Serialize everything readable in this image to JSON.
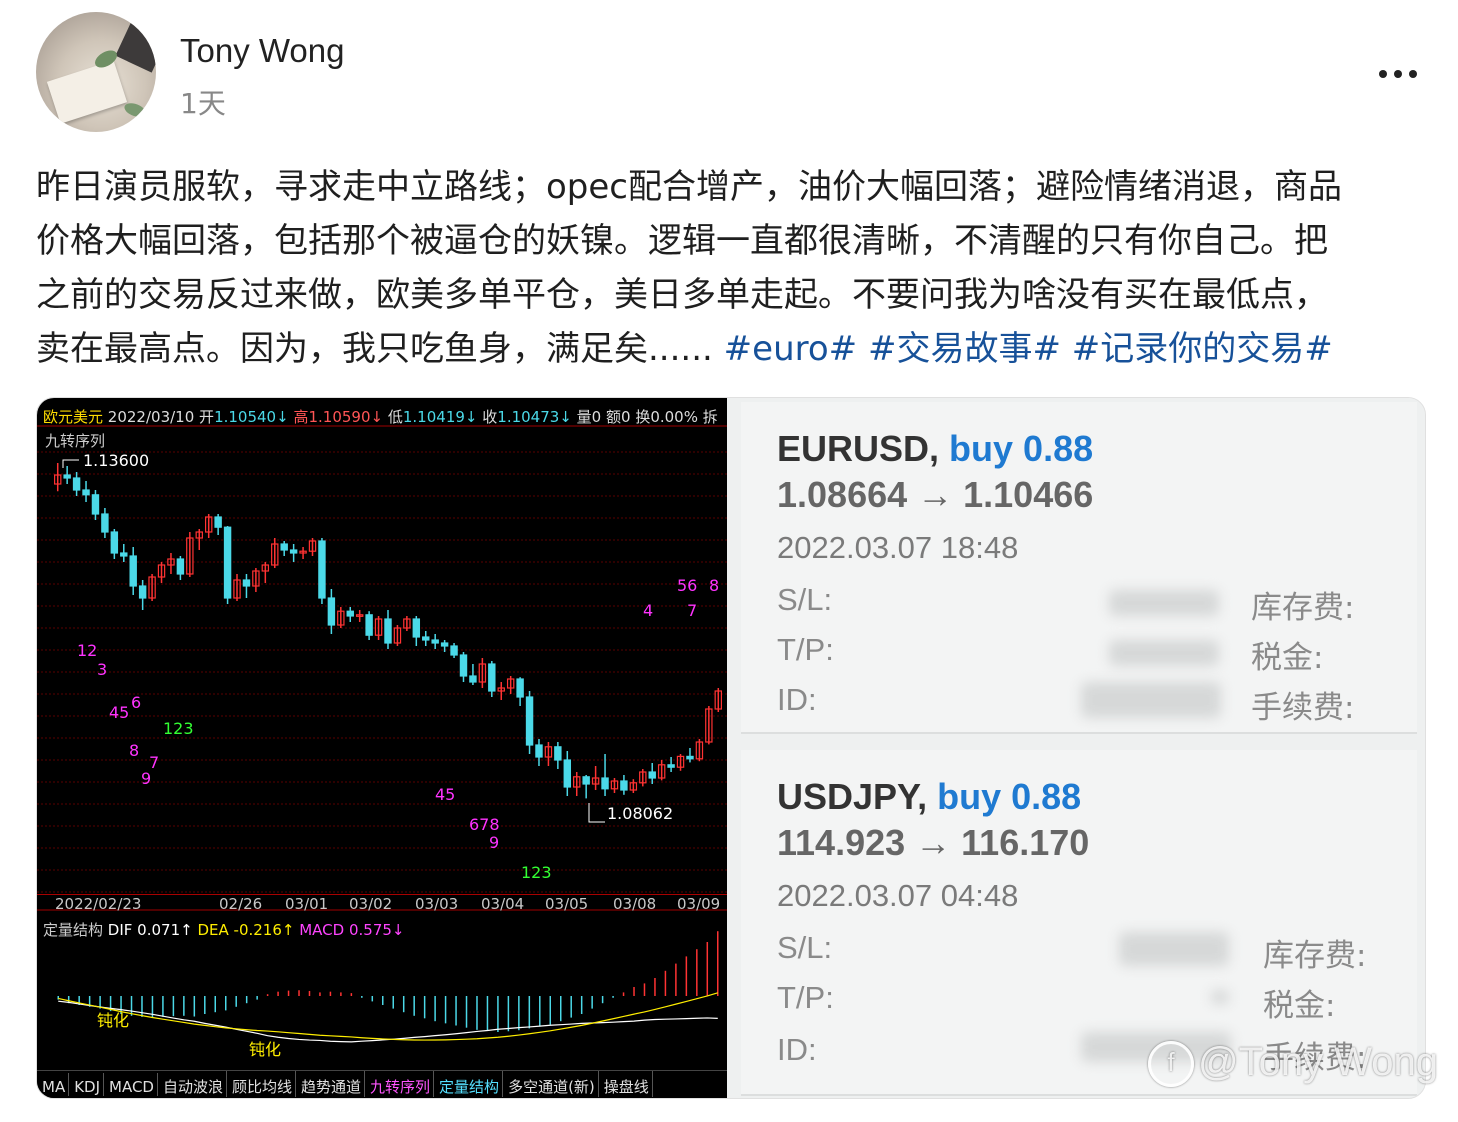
{
  "author": {
    "name": "Tony Wong",
    "time": "1天"
  },
  "more_icon": "more-dots-icon",
  "post": {
    "lines": [
      "昨日演员服软，寻求走中立路线；opec配合增产，油价大幅回落；避险情绪消退，商品",
      "价格大幅回落，包括那个被逼仓的妖镍。逻辑一直都很清晰，不清醒的只有你自己。把",
      "之前的交易反过来做，欧美多单平仓，美日多单走起。不要问我为啥没有买在最低点，"
    ],
    "last_line": "卖在最高点。因为，我只吃鱼身，满足矣......",
    "hashtags": [
      "#euro#",
      "#交易故事#",
      "#记录你的交易#"
    ]
  },
  "chart": {
    "name": "欧元美元",
    "date": "2022/03/10",
    "open_label": "开",
    "open": "1.10540↓",
    "high_label": "高",
    "high": "1.10590↓",
    "low_label": "低",
    "low": "1.10419↓",
    "close_label": "收",
    "close": "1.10473↓",
    "volume": "量0",
    "amount": "额0",
    "turnover": "换0.00%",
    "extra": "拆",
    "indicator": "九转序列",
    "high_marker": "1.13600",
    "low_marker": "1.08062",
    "dates": [
      "2022/02/23",
      "02/26",
      "03/01",
      "03/02",
      "03/03",
      "03/04",
      "03/05",
      "03/08",
      "03/09"
    ],
    "macd_label": "定量结构",
    "dif": "DIF 0.071↑",
    "dea": "DEA -0.216↑",
    "macd": "MACD 0.575↓",
    "tags": [
      "钝化",
      "钝化"
    ],
    "seq_labels": [
      "12",
      "3",
      "45",
      "6",
      "8",
      "7",
      "9",
      "123",
      "45",
      "678",
      "9",
      "123",
      "4",
      "56",
      "7",
      "8"
    ],
    "tabs": [
      "MA",
      "KDJ",
      "MACD",
      "自动波浪",
      "顾比均线",
      "趋势通道",
      "九转序列",
      "定量结构",
      "多空通道(新)",
      "操盘线"
    ],
    "colors": {
      "up": "#ff3333",
      "down": "#4bd9e8",
      "seq_magenta": "#ff33ff",
      "seq_green": "#33ff33"
    }
  },
  "chart_data": {
    "type": "candlestick",
    "series": [
      {
        "o": 1.133,
        "h": 1.1365,
        "l": 1.1318,
        "c": 1.1345
      },
      {
        "o": 1.1345,
        "h": 1.136,
        "l": 1.133,
        "c": 1.134
      },
      {
        "o": 1.134,
        "h": 1.135,
        "l": 1.131,
        "c": 1.132
      },
      {
        "o": 1.132,
        "h": 1.1335,
        "l": 1.13,
        "c": 1.1312
      },
      {
        "o": 1.1312,
        "h": 1.132,
        "l": 1.127,
        "c": 1.128
      },
      {
        "o": 1.128,
        "h": 1.129,
        "l": 1.124,
        "c": 1.125
      },
      {
        "o": 1.125,
        "h": 1.1255,
        "l": 1.1205,
        "c": 1.1215
      },
      {
        "o": 1.1215,
        "h": 1.123,
        "l": 1.12,
        "c": 1.121
      },
      {
        "o": 1.121,
        "h": 1.1225,
        "l": 1.1145,
        "c": 1.116
      },
      {
        "o": 1.116,
        "h": 1.117,
        "l": 1.112,
        "c": 1.114
      },
      {
        "o": 1.114,
        "h": 1.118,
        "l": 1.1135,
        "c": 1.1175
      },
      {
        "o": 1.1175,
        "h": 1.12,
        "l": 1.1165,
        "c": 1.1195
      },
      {
        "o": 1.1195,
        "h": 1.1215,
        "l": 1.118,
        "c": 1.1205
      },
      {
        "o": 1.1205,
        "h": 1.121,
        "l": 1.117,
        "c": 1.118
      },
      {
        "o": 1.118,
        "h": 1.125,
        "l": 1.1175,
        "c": 1.124
      },
      {
        "o": 1.124,
        "h": 1.1255,
        "l": 1.122,
        "c": 1.125
      },
      {
        "o": 1.125,
        "h": 1.128,
        "l": 1.124,
        "c": 1.1275
      },
      {
        "o": 1.1275,
        "h": 1.128,
        "l": 1.1245,
        "c": 1.1258
      },
      {
        "o": 1.1258,
        "h": 1.126,
        "l": 1.113,
        "c": 1.114
      },
      {
        "o": 1.114,
        "h": 1.118,
        "l": 1.1135,
        "c": 1.117
      },
      {
        "o": 1.117,
        "h": 1.118,
        "l": 1.114,
        "c": 1.116
      },
      {
        "o": 1.116,
        "h": 1.119,
        "l": 1.115,
        "c": 1.1185
      },
      {
        "o": 1.1185,
        "h": 1.12,
        "l": 1.1165,
        "c": 1.1195
      },
      {
        "o": 1.1195,
        "h": 1.124,
        "l": 1.119,
        "c": 1.123
      },
      {
        "o": 1.123,
        "h": 1.1235,
        "l": 1.121,
        "c": 1.122
      },
      {
        "o": 1.122,
        "h": 1.123,
        "l": 1.12,
        "c": 1.1215
      },
      {
        "o": 1.1215,
        "h": 1.1225,
        "l": 1.1205,
        "c": 1.1218
      },
      {
        "o": 1.1218,
        "h": 1.124,
        "l": 1.121,
        "c": 1.1235
      },
      {
        "o": 1.1235,
        "h": 1.124,
        "l": 1.113,
        "c": 1.114
      },
      {
        "o": 1.114,
        "h": 1.1155,
        "l": 1.108,
        "c": 1.1095
      },
      {
        "o": 1.1095,
        "h": 1.1125,
        "l": 1.109,
        "c": 1.1118
      },
      {
        "o": 1.1118,
        "h": 1.1125,
        "l": 1.11,
        "c": 1.111
      },
      {
        "o": 1.111,
        "h": 1.112,
        "l": 1.11,
        "c": 1.1112
      },
      {
        "o": 1.1112,
        "h": 1.1118,
        "l": 1.107,
        "c": 1.1078
      },
      {
        "o": 1.1078,
        "h": 1.111,
        "l": 1.107,
        "c": 1.1105
      },
      {
        "o": 1.1105,
        "h": 1.112,
        "l": 1.1055,
        "c": 1.1065
      },
      {
        "o": 1.1065,
        "h": 1.1095,
        "l": 1.106,
        "c": 1.109
      },
      {
        "o": 1.109,
        "h": 1.111,
        "l": 1.1085,
        "c": 1.1105
      },
      {
        "o": 1.1105,
        "h": 1.111,
        "l": 1.106,
        "c": 1.1075
      },
      {
        "o": 1.1075,
        "h": 1.1085,
        "l": 1.106,
        "c": 1.107
      },
      {
        "o": 1.107,
        "h": 1.108,
        "l": 1.1055,
        "c": 1.1065
      },
      {
        "o": 1.1065,
        "h": 1.107,
        "l": 1.105,
        "c": 1.106
      },
      {
        "o": 1.106,
        "h": 1.1065,
        "l": 1.104,
        "c": 1.1045
      },
      {
        "o": 1.1045,
        "h": 1.105,
        "l": 1.1,
        "c": 1.101
      },
      {
        "o": 1.101,
        "h": 1.103,
        "l": 1.0995,
        "c": 1.1
      },
      {
        "o": 1.1,
        "h": 1.104,
        "l": 1.099,
        "c": 1.103
      },
      {
        "o": 1.103,
        "h": 1.1035,
        "l": 1.0975,
        "c": 1.0985
      },
      {
        "o": 1.0985,
        "h": 1.1,
        "l": 1.097,
        "c": 1.099
      },
      {
        "o": 1.099,
        "h": 1.101,
        "l": 1.098,
        "c": 1.1005
      },
      {
        "o": 1.1005,
        "h": 1.1008,
        "l": 1.096,
        "c": 1.0975
      },
      {
        "o": 1.0975,
        "h": 1.0985,
        "l": 1.088,
        "c": 1.0895
      },
      {
        "o": 1.0895,
        "h": 1.0905,
        "l": 1.086,
        "c": 1.0875
      },
      {
        "o": 1.0875,
        "h": 1.09,
        "l": 1.086,
        "c": 1.0892
      },
      {
        "o": 1.0892,
        "h": 1.09,
        "l": 1.0855,
        "c": 1.087
      },
      {
        "o": 1.087,
        "h": 1.0885,
        "l": 1.081,
        "c": 1.0825
      },
      {
        "o": 1.0825,
        "h": 1.085,
        "l": 1.081,
        "c": 1.0842
      },
      {
        "o": 1.0842,
        "h": 1.0845,
        "l": 1.0806,
        "c": 1.083
      },
      {
        "o": 1.083,
        "h": 1.086,
        "l": 1.082,
        "c": 1.084
      },
      {
        "o": 1.084,
        "h": 1.088,
        "l": 1.081,
        "c": 1.0822
      },
      {
        "o": 1.0822,
        "h": 1.084,
        "l": 1.0815,
        "c": 1.0835
      },
      {
        "o": 1.0835,
        "h": 1.0845,
        "l": 1.0812,
        "c": 1.082
      },
      {
        "o": 1.082,
        "h": 1.0838,
        "l": 1.0815,
        "c": 1.0832
      },
      {
        "o": 1.0832,
        "h": 1.0855,
        "l": 1.0826,
        "c": 1.085
      },
      {
        "o": 1.085,
        "h": 1.0865,
        "l": 1.083,
        "c": 1.084
      },
      {
        "o": 1.084,
        "h": 1.087,
        "l": 1.0836,
        "c": 1.0862
      },
      {
        "o": 1.0862,
        "h": 1.0875,
        "l": 1.085,
        "c": 1.0858
      },
      {
        "o": 1.0858,
        "h": 1.088,
        "l": 1.0852,
        "c": 1.0876
      },
      {
        "o": 1.0876,
        "h": 1.089,
        "l": 1.0866,
        "c": 1.0872
      },
      {
        "o": 1.0872,
        "h": 1.0905,
        "l": 1.0868,
        "c": 1.09
      },
      {
        "o": 1.09,
        "h": 1.096,
        "l": 1.0896,
        "c": 1.0955
      },
      {
        "o": 1.0955,
        "h": 1.099,
        "l": 1.095,
        "c": 1.0985
      }
    ],
    "y_range": [
      1.079,
      1.138
    ],
    "macd_hist": [
      -0.1,
      -0.2,
      -0.25,
      -0.3,
      -0.35,
      -0.42,
      -0.5,
      -0.55,
      -0.58,
      -0.6,
      -0.58,
      -0.56,
      -0.55,
      -0.57,
      -0.5,
      -0.45,
      -0.4,
      -0.3,
      -0.2,
      -0.1,
      0.05,
      0.12,
      0.15,
      0.16,
      0.14,
      0.1,
      0.12,
      0.1,
      0.08,
      -0.05,
      -0.15,
      -0.25,
      -0.35,
      -0.45,
      -0.55,
      -0.62,
      -0.7,
      -0.76,
      -0.82,
      -0.88,
      -0.94,
      -0.96,
      -1.0,
      -0.98,
      -0.95,
      -0.9,
      -0.85,
      -0.8,
      -0.7,
      -0.6,
      -0.5,
      -0.35,
      -0.2,
      -0.05,
      0.1,
      0.25,
      0.35,
      0.5,
      0.7,
      0.9,
      1.1,
      1.3,
      1.5,
      1.8
    ]
  },
  "trades": [
    {
      "symbol": "EURUSD,",
      "side": "buy 0.88",
      "prices": "1.08664 → 1.10466",
      "datetime": "2022.03.07 18:48",
      "labels": [
        "S/L:",
        "T/P:",
        "ID:"
      ],
      "right_labels": [
        "库存费:",
        "税金:",
        "手续费:"
      ]
    },
    {
      "symbol": "USDJPY,",
      "side": "buy 0.88",
      "prices": "114.923 → 116.170",
      "datetime": "2022.03.07 04:48",
      "labels": [
        "S/L:",
        "T/P:",
        "ID:"
      ],
      "right_labels": [
        "库存费:",
        "税金:",
        "手续费:"
      ]
    }
  ],
  "watermark": {
    "icon": "zhihu-logo-icon",
    "text": "@Tony Wong"
  }
}
